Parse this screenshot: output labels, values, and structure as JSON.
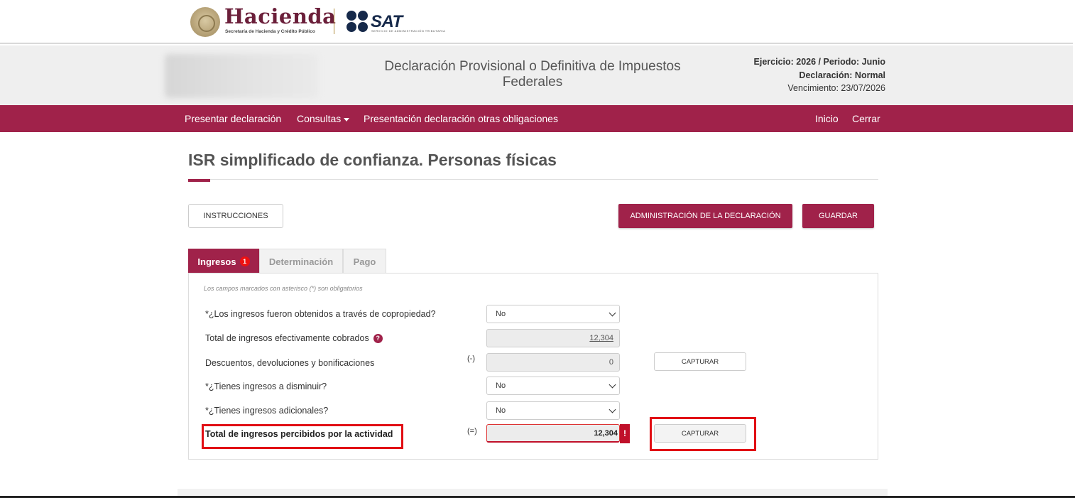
{
  "brand": {
    "hacienda": "Hacienda",
    "hacienda_sub": "Secretaría de Hacienda y Crédito Público",
    "sat": "SAT",
    "sat_sub": "SERVICIO DE ADMINISTRACIÓN TRIBUTARIA"
  },
  "header": {
    "title_line1": "Declaración Provisional o Definitiva de Impuestos",
    "title_line2": "Federales",
    "ejercicio": "Ejercicio: 2026 / Periodo: Junio",
    "declaracion": "Declaración: Normal",
    "vencimiento": "Vencimiento: 23/07/2026"
  },
  "nav": {
    "presentar": "Presentar declaración",
    "consultas": "Consultas",
    "otras": "Presentación declaración otras obligaciones",
    "inicio": "Inicio",
    "cerrar": "Cerrar"
  },
  "page": {
    "title": "ISR simplificado de confianza. Personas físicas"
  },
  "actions": {
    "instrucciones": "INSTRUCCIONES",
    "administracion": "ADMINISTRACIÓN DE LA DECLARACIÓN",
    "guardar": "GUARDAR"
  },
  "tabs": {
    "ingresos": "Ingresos",
    "ingresos_badge": "1",
    "determinacion": "Determinación",
    "pago": "Pago"
  },
  "form": {
    "note": "Los campos marcados con asterisco (*) son obligatorios",
    "copropiedad_label": "*¿Los ingresos fueron obtenidos a través de copropiedad?",
    "copropiedad_value": "No",
    "cobrados_label": "Total de ingresos efectivamente cobrados",
    "cobrados_value": "12,304",
    "descuentos_label": "Descuentos, devoluciones y bonificaciones",
    "descuentos_sign": "(-)",
    "descuentos_value": "0",
    "capturar": "CAPTURAR",
    "disminuir_label": "*¿Tienes ingresos a disminuir?",
    "disminuir_value": "No",
    "adicionales_label": "*¿Tienes ingresos adicionales?",
    "adicionales_value": "No",
    "total_label": "Total de ingresos percibidos por la actividad",
    "total_sign": "(=)",
    "total_value": "12,304",
    "error_mark": "!"
  },
  "colors": {
    "primary": "#a0224a",
    "highlight": "#e10e14"
  }
}
